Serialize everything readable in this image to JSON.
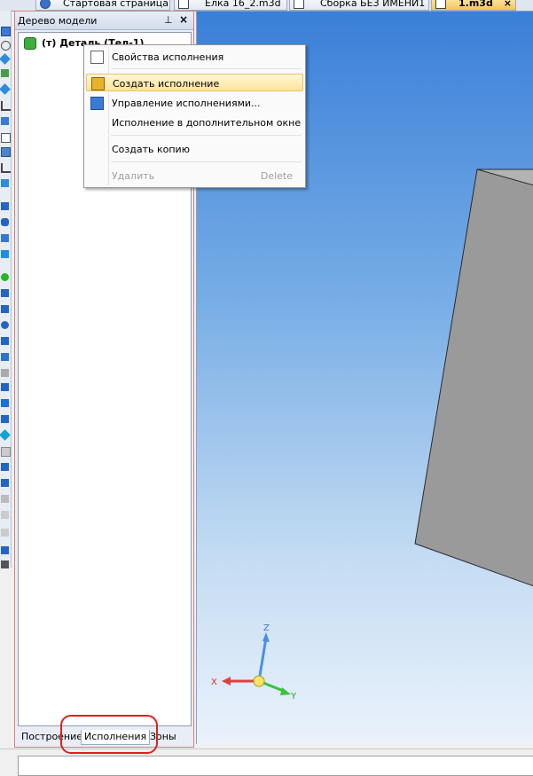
{
  "tabs": [
    {
      "label": "Стартовая страница",
      "icon": "start-page-icon"
    },
    {
      "label": "Елка 16_2.m3d",
      "icon": "part-file-icon"
    },
    {
      "label": "Сборка БЕЗ ИМЕНИ1",
      "icon": "assembly-file-icon"
    },
    {
      "label": "1.m3d",
      "icon": "part-file-icon",
      "active": true,
      "close": "×"
    }
  ],
  "panel": {
    "title": "Дерево модели",
    "pin": "⊥",
    "close": "×",
    "root_node": "(т) Деталь (Тел-1)",
    "bottom_tabs": [
      "Построение",
      "Исполнения",
      "Зоны"
    ],
    "active_tab": "Исполнения"
  },
  "context_menu": {
    "items": [
      {
        "label": "Свойства исполнения",
        "icon": "properties-icon"
      },
      {
        "label": "Создать исполнение",
        "icon": "create-variant-icon",
        "highlighted": true
      },
      {
        "label": "Управление исполнениями...",
        "icon": "manage-variants-icon"
      },
      {
        "label": "Исполнение в дополнительном окне"
      },
      {
        "label": "Создать копию"
      },
      {
        "label": "Удалить",
        "shortcut": "Delete",
        "disabled": true
      }
    ]
  },
  "axes": {
    "x": "X",
    "y": "Y",
    "z": "Z"
  },
  "colors": {
    "accent_highlight": "#ffe39a",
    "callout_red": "#e02020",
    "viewport_top": "#3a7fd8",
    "viewport_bottom": "#eaf2fb",
    "model_face": "#9a9a9a"
  }
}
